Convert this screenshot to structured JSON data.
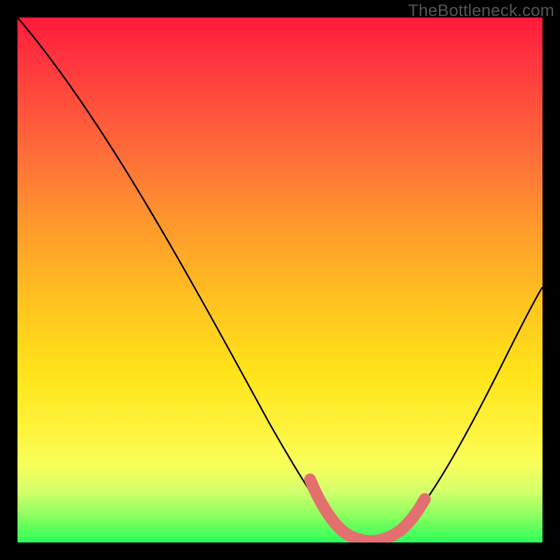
{
  "watermark": "TheBottleneck.com",
  "chart_data": {
    "type": "line",
    "title": "",
    "xlabel": "",
    "ylabel": "",
    "xlim": [
      0,
      100
    ],
    "ylim": [
      0,
      100
    ],
    "series": [
      {
        "name": "bottleneck-curve",
        "x": [
          0,
          5,
          10,
          15,
          20,
          25,
          30,
          35,
          40,
          45,
          50,
          55,
          58,
          60,
          63,
          65,
          68,
          70,
          73,
          76,
          80,
          85,
          90,
          95,
          100
        ],
        "values": [
          100,
          92,
          84,
          76,
          68,
          60,
          52,
          44,
          36,
          28,
          20,
          12,
          7,
          4,
          2,
          0.5,
          0,
          0,
          0.5,
          2,
          6,
          14,
          24,
          35,
          47
        ]
      }
    ],
    "highlight_segment": {
      "name": "optimal-zone",
      "color": "#e46f6f",
      "x": [
        55,
        58,
        60,
        63,
        65,
        68,
        70,
        73,
        76
      ],
      "values": [
        12,
        7,
        4,
        2,
        0.5,
        0,
        0,
        0.5,
        2
      ]
    },
    "background_gradient": {
      "top_color": "#ff1a3a",
      "mid_color": "#ffe41a",
      "bottom_color": "#2aff5a"
    }
  }
}
